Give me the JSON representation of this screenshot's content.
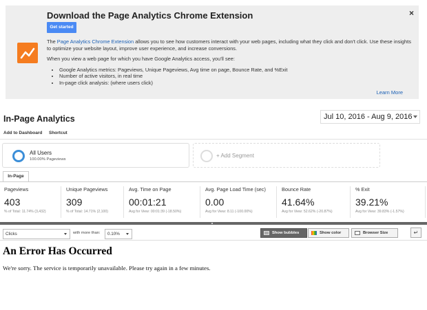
{
  "promo": {
    "title": "Download the Page Analytics Chrome Extension",
    "close": "×",
    "button": "Get started",
    "intro_link": "Page Analytics Chrome Extension",
    "intro_prefix": "The ",
    "intro_suffix": " allows you to see how customers interact with your web pages, including what they click and don't click. Use these insights to optimize your website layout, improve user experience, and increase conversions.",
    "subhead": "When you view a web page for which you have Google Analytics access, you'll see:",
    "bullets": [
      "Google Analytics metrics: Pageviews, Unique Pageviews, Avg time on page, Bounce Rate, and %Exit",
      "Number of active visitors, in real time",
      "In-page click analysis: (where users click)"
    ],
    "learn_more": "Learn More",
    "logo_color": "#f57c1f"
  },
  "report": {
    "title": "In-Page Analytics",
    "date_range": "Jul 10, 2016 - Aug 9, 2016",
    "add_to_dashboard": "Add to Dashboard",
    "shortcut": "Shortcut"
  },
  "segments": {
    "active_name": "All Users",
    "active_sub": "100.00% Pageviews",
    "add_label": "+ Add Segment",
    "ring_color": "#3b8ed8"
  },
  "tab": "In-Page",
  "metrics": [
    {
      "label": "Pageviews",
      "value": "403",
      "sub": "% of Total: 11.74% (3,432)"
    },
    {
      "label": "Unique Pageviews",
      "value": "309",
      "sub": "% of Total: 14.71% (2,100)"
    },
    {
      "label": "Avg. Time on Page",
      "value": "00:01:21",
      "sub": "Avg for View: 00:01:39 (-18.50%)"
    },
    {
      "label": "Avg. Page Load Time (sec)",
      "value": "0.00",
      "sub": "Avg for View: 8.11 (-100.00%)"
    },
    {
      "label": "Bounce Rate",
      "value": "41.64%",
      "sub": "Avg for View: 52.62% (-20.87%)"
    },
    {
      "label": "% Exit",
      "value": "39.21%",
      "sub": "Avg for View: 39.83% (-1.57%)"
    }
  ],
  "controls": {
    "metric_select": "Clicks",
    "more_than_label": "with more than:",
    "threshold_select": "0.10%",
    "show_bubbles": "Show bubbles",
    "show_color": "Show color",
    "browser_size": "Browser Size",
    "popout": "↵"
  },
  "error": {
    "title": "An Error Has Occurred",
    "message": "We're sorry. The service is temporarily unavailable. Please try again in a few minutes."
  }
}
